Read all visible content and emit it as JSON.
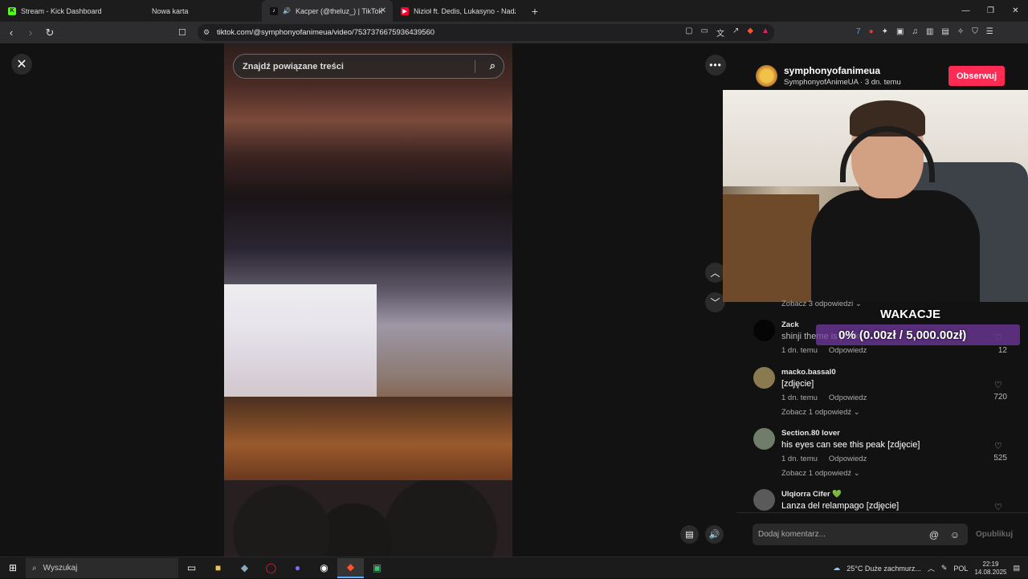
{
  "browser": {
    "tabs": [
      {
        "title": "Stream - Kick Dashboard",
        "icon": "kick-icon",
        "color": "#53fc18"
      },
      {
        "title": "Nowa karta",
        "icon": "blank-icon",
        "color": "#555555"
      },
      {
        "title": "Kacper (@theluz_) | TikTok",
        "icon": "tiktok-icon",
        "color": "#111111",
        "active": true,
        "audio": true
      },
      {
        "title": "Nizioł ft. Dedis, Lukasyno - Nadzieja",
        "icon": "youtube-icon",
        "color": "#ff0033"
      }
    ],
    "new_tab": "+",
    "url": "tiktok.com/@symphonyofanimeua/video/7537376675936439560",
    "window_controls": [
      "—",
      "❐",
      "✕"
    ]
  },
  "video": {
    "search_placeholder": "Znajdź powiązane treści"
  },
  "author": {
    "handle": "symphonyofanimeua",
    "subtitle": "SymphonyofAnimeUA · 3 dn. temu",
    "follow_label": "Obserwuj"
  },
  "comments": {
    "top_see_replies": "Zobacz 3 odpowiedzi",
    "items": [
      {
        "name": "Zack",
        "text": "shinji theme is peak",
        "time": "1 dn. temu",
        "reply": "Odpowiedz",
        "likes": "12",
        "avatar_color": "#050505"
      },
      {
        "name": "macko.bassal0",
        "text": "[zdjęcie]",
        "time": "1 dn. temu",
        "reply": "Odpowiedz",
        "likes": "720",
        "avatar_color": "#8a7a50",
        "see_replies": "Zobacz 1 odpowiedź"
      },
      {
        "name": "Section.80 lover",
        "text": "his eyes can see this peak [zdjęcie]",
        "time": "1 dn. temu",
        "reply": "Odpowiedz",
        "likes": "525",
        "avatar_color": "#6f7d6a",
        "see_replies": "Zobacz 1 odpowiedź"
      },
      {
        "name": "Ulqiorra Cifer",
        "text": "Lanza del relampago [zdjęcie]",
        "avatar_color": "#5a5a5a",
        "badge": "💚"
      }
    ]
  },
  "stream_overlay": {
    "goal_title": "WAKACJE",
    "goal_text": "0% (0.00zł / 5,000.00zł)",
    "goal_progress": 0.0
  },
  "comment_input": {
    "placeholder": "Dodaj komentarz...",
    "publish_label": "Opublikuj"
  },
  "taskbar": {
    "search_placeholder": "Wyszukaj",
    "weather": "25°C  Duże zachmurz...",
    "language": "POL",
    "time": "22:19",
    "date": "14.08.2025"
  }
}
